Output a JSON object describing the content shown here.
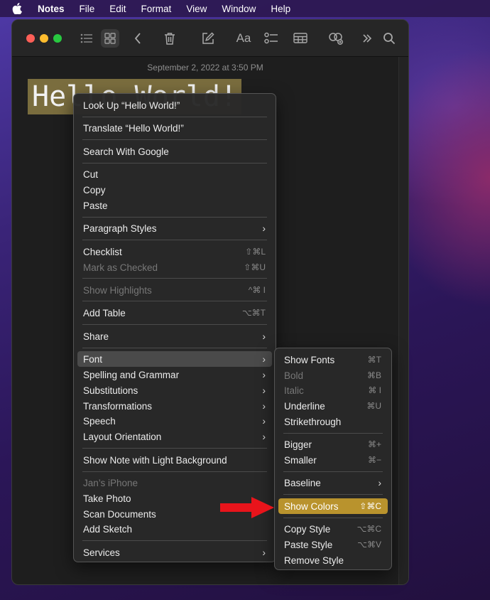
{
  "menubar": {
    "app_name": "Notes",
    "items": [
      "File",
      "Edit",
      "Format",
      "View",
      "Window",
      "Help"
    ]
  },
  "toolbar": {
    "icons": [
      "list-view-icon",
      "gallery-view-icon",
      "back-icon",
      "trash-icon",
      "compose-icon",
      "font-format-icon",
      "checklist-icon",
      "table-icon",
      "collaborate-icon",
      "more-icon",
      "search-icon"
    ],
    "font_format_label": "Aa"
  },
  "note": {
    "date": "September 2, 2022 at 3:50 PM",
    "text": "Hello World!"
  },
  "context_menu": {
    "items": [
      {
        "label": "Look Up “Hello World!”",
        "shortcut": "",
        "submenu": false,
        "disabled": false
      },
      {
        "label": "Translate “Hello World!”",
        "shortcut": "",
        "submenu": false,
        "disabled": false
      },
      {
        "label": "Search With Google",
        "shortcut": "",
        "submenu": false,
        "disabled": false
      },
      {
        "label": "Cut",
        "shortcut": "",
        "submenu": false,
        "disabled": false
      },
      {
        "label": "Copy",
        "shortcut": "",
        "submenu": false,
        "disabled": false
      },
      {
        "label": "Paste",
        "shortcut": "",
        "submenu": false,
        "disabled": false
      },
      {
        "label": "Paragraph Styles",
        "shortcut": "",
        "submenu": true,
        "disabled": false
      },
      {
        "label": "Checklist",
        "shortcut": "⇧⌘L",
        "submenu": false,
        "disabled": false
      },
      {
        "label": "Mark as Checked",
        "shortcut": "⇧⌘U",
        "submenu": false,
        "disabled": true
      },
      {
        "label": "Show Highlights",
        "shortcut": "^⌘ I",
        "submenu": false,
        "disabled": true
      },
      {
        "label": "Add Table",
        "shortcut": "⌥⌘T",
        "submenu": false,
        "disabled": false
      },
      {
        "label": "Share",
        "shortcut": "",
        "submenu": true,
        "disabled": false
      },
      {
        "label": "Font",
        "shortcut": "",
        "submenu": true,
        "disabled": false,
        "highlighted": true
      },
      {
        "label": "Spelling and Grammar",
        "shortcut": "",
        "submenu": true,
        "disabled": false
      },
      {
        "label": "Substitutions",
        "shortcut": "",
        "submenu": true,
        "disabled": false
      },
      {
        "label": "Transformations",
        "shortcut": "",
        "submenu": true,
        "disabled": false
      },
      {
        "label": "Speech",
        "shortcut": "",
        "submenu": true,
        "disabled": false
      },
      {
        "label": "Layout Orientation",
        "shortcut": "",
        "submenu": true,
        "disabled": false
      },
      {
        "label": "Show Note with Light Background",
        "shortcut": "",
        "submenu": false,
        "disabled": false
      },
      {
        "label": "Jan’s iPhone",
        "shortcut": "",
        "submenu": false,
        "disabled": true
      },
      {
        "label": "Take Photo",
        "shortcut": "",
        "submenu": false,
        "disabled": false
      },
      {
        "label": "Scan Documents",
        "shortcut": "",
        "submenu": false,
        "disabled": false
      },
      {
        "label": "Add Sketch",
        "shortcut": "",
        "submenu": false,
        "disabled": false
      },
      {
        "label": "Services",
        "shortcut": "",
        "submenu": true,
        "disabled": false
      }
    ]
  },
  "font_submenu": {
    "items": [
      {
        "label": "Show Fonts",
        "shortcut": "⌘T",
        "submenu": false,
        "disabled": false
      },
      {
        "label": "Bold",
        "shortcut": "⌘B",
        "submenu": false,
        "disabled": true
      },
      {
        "label": "Italic",
        "shortcut": "⌘ I",
        "submenu": false,
        "disabled": true
      },
      {
        "label": "Underline",
        "shortcut": "⌘U",
        "submenu": false,
        "disabled": false
      },
      {
        "label": "Strikethrough",
        "shortcut": "",
        "submenu": false,
        "disabled": false
      },
      {
        "label": "Bigger",
        "shortcut": "⌘+",
        "submenu": false,
        "disabled": false
      },
      {
        "label": "Smaller",
        "shortcut": "⌘−",
        "submenu": false,
        "disabled": false
      },
      {
        "label": "Baseline",
        "shortcut": "",
        "submenu": true,
        "disabled": false
      },
      {
        "label": "Show Colors",
        "shortcut": "⇧⌘C",
        "submenu": false,
        "disabled": false,
        "selected": true
      },
      {
        "label": "Copy Style",
        "shortcut": "⌥⌘C",
        "submenu": false,
        "disabled": false
      },
      {
        "label": "Paste Style",
        "shortcut": "⌥⌘V",
        "submenu": false,
        "disabled": false
      },
      {
        "label": "Remove Style",
        "shortcut": "",
        "submenu": false,
        "disabled": false
      }
    ]
  },
  "colors": {
    "selection_highlight": "#b9932d",
    "text_highlight": "#7a6d3e",
    "annotation_arrow": "#e8141b"
  }
}
